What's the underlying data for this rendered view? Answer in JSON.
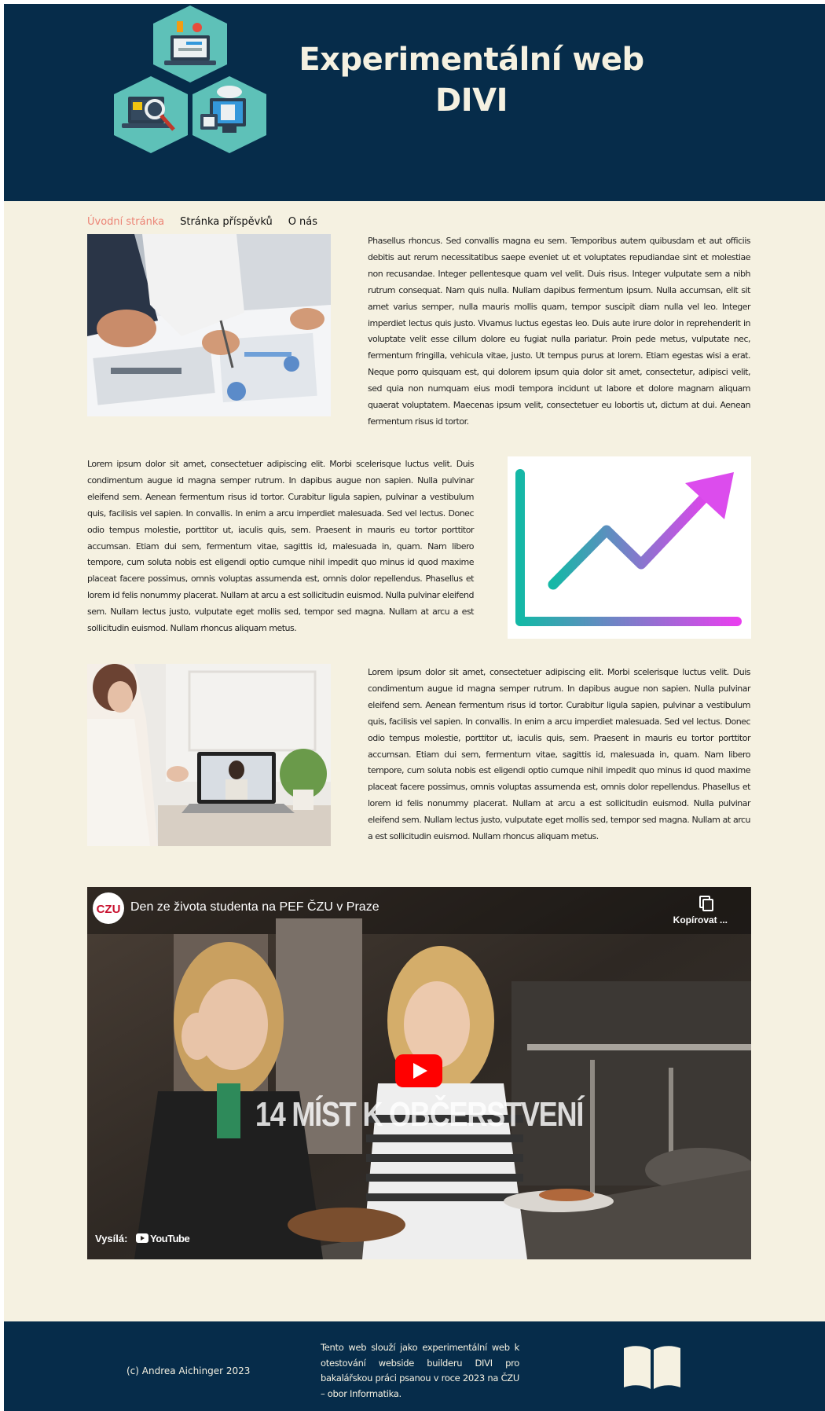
{
  "header": {
    "title": "Experimentální web DIVI",
    "logo_icon": "hexagon-devices-logo"
  },
  "nav": {
    "items": [
      {
        "label": "Úvodní stránka",
        "active": true
      },
      {
        "label": "Stránka příspěvků",
        "active": false
      },
      {
        "label": "O nás",
        "active": false
      }
    ]
  },
  "sections": {
    "first": {
      "image": "business-meeting-charts-photo",
      "text": "Phasellus rhoncus. Sed convallis magna eu sem. Temporibus autem quibusdam et aut officiis debitis aut rerum necessitatibus saepe eveniet ut et voluptates repudiandae sint et molestiae non recusandae. Integer pellentesque quam vel velit. Duis risus. Integer vulputate sem a nibh rutrum consequat. Nam quis nulla. Nullam dapibus fermentum ipsum. Nulla accumsan, elit sit amet varius semper, nulla mauris mollis quam, tempor suscipit diam nulla vel leo. Integer imperdiet lectus quis justo. Vivamus luctus egestas leo. Duis aute irure dolor in reprehenderit in voluptate velit esse cillum dolore eu fugiat nulla pariatur. Proin pede metus, vulputate nec, fermentum fringilla, vehicula vitae, justo. Ut tempus purus at lorem. Etiam egestas wisi a erat. Neque porro quisquam est, qui dolorem ipsum quia dolor sit amet, consectetur, adipisci velit, sed quia non numquam eius modi tempora incidunt ut labore et dolore magnam aliquam quaerat voluptatem. Maecenas ipsum velit, consectetuer eu lobortis ut, dictum at dui. Aenean fermentum risus id tortor."
    },
    "second": {
      "image": "growth-arrow-chart-graphic",
      "text": "Lorem ipsum dolor sit amet, consectetuer adipiscing elit. Morbi scelerisque luctus velit. Duis condimentum augue id magna semper rutrum. In dapibus augue non sapien. Nulla pulvinar eleifend sem. Aenean fermentum risus id tortor. Curabitur ligula sapien, pulvinar a vestibulum quis, facilisis vel sapien. In convallis. In enim a arcu imperdiet malesuada. Sed vel lectus. Donec odio tempus molestie, porttitor ut, iaculis quis, sem. Praesent in mauris eu tortor porttitor accumsan. Etiam dui sem, fermentum vitae, sagittis id, malesuada in, quam. Nam libero tempore, cum soluta nobis est eligendi optio cumque nihil impedit quo minus id quod maxime placeat facere possimus, omnis voluptas assumenda est, omnis dolor repellendus. Phasellus et lorem id felis nonummy placerat. Nullam at arcu a est sollicitudin euismod. Nulla pulvinar eleifend sem. Nullam lectus justo, vulputate eget mollis sed, tempor sed magna. Nullam at arcu a est sollicitudin euismod. Nullam rhoncus aliquam metus."
    },
    "third": {
      "image": "online-video-call-photo",
      "text": "Lorem ipsum dolor sit amet, consectetuer adipiscing elit. Morbi scelerisque luctus velit. Duis condimentum augue id magna semper rutrum. In dapibus augue non sapien. Nulla pulvinar eleifend sem. Aenean fermentum risus id tortor. Curabitur ligula sapien, pulvinar a vestibulum quis, facilisis vel sapien. In convallis. In enim a arcu imperdiet malesuada. Sed vel lectus. Donec odio tempus molestie, porttitor ut, iaculis quis, sem. Praesent in mauris eu tortor porttitor accumsan. Etiam dui sem, fermentum vitae, sagittis id, malesuada in, quam. Nam libero tempore, cum soluta nobis est eligendi optio cumque nihil impedit quo minus id quod maxime placeat facere possimus, omnis voluptas assumenda est, omnis dolor repellendus. Phasellus et lorem id felis nonummy placerat. Nullam at arcu a est sollicitudin euismod. Nulla pulvinar eleifend sem. Nullam lectus justo, vulputate eget mollis sed, tempor sed magna. Nullam at arcu a est sollicitudin euismod. Nullam rhoncus aliquam metus."
    }
  },
  "video": {
    "title": "Den ze života studenta na PEF ČZU v Praze",
    "channel_logo": "CZU",
    "copy_label": "Kopírovat ...",
    "overlay_text": "14 MÍST K OBČERSTVENÍ",
    "broadcast_label": "Vysílá:",
    "brand": "YouTube"
  },
  "footer": {
    "copyright": "(c) Andrea Aichinger 2023",
    "about": "Tento web slouží jako experimentální web k otestování webside builderu DIVI pro bakalářskou práci psanou v roce 2023 na ČZU – obor Informatika.",
    "icon": "open-book-icon"
  },
  "colors": {
    "header_bg": "#062c4a",
    "page_bg": "#f5f1e1",
    "nav_active": "#ec8476",
    "hexagon": "#5ec1b8"
  }
}
